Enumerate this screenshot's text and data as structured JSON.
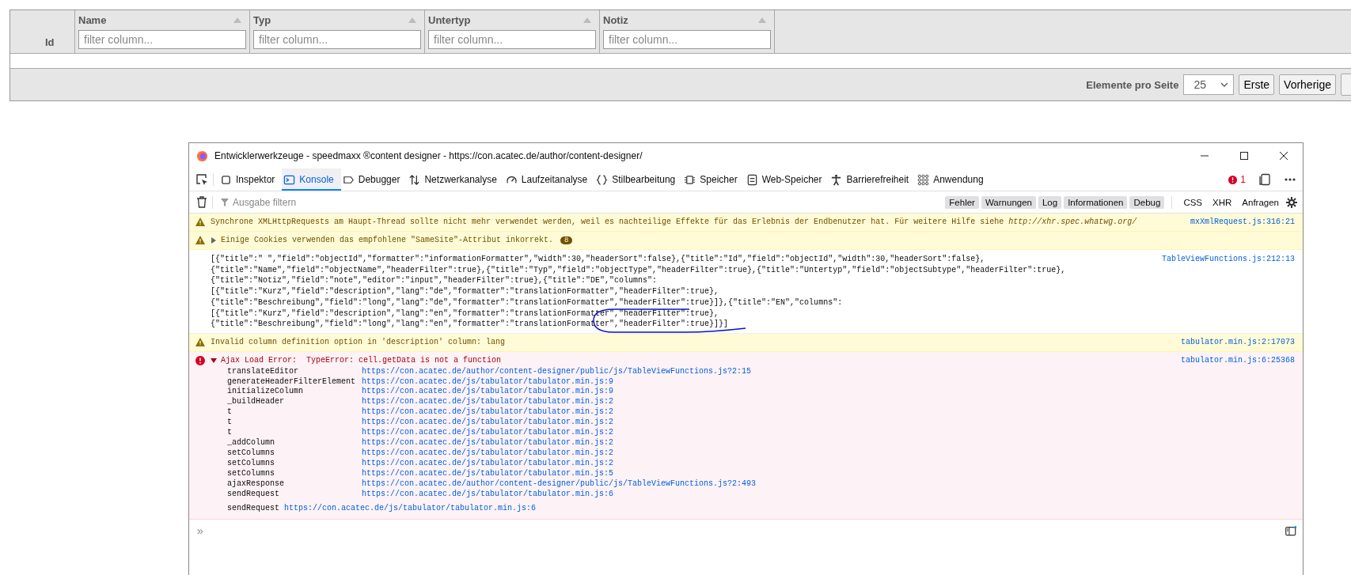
{
  "table": {
    "id_column": "Id",
    "columns": [
      {
        "title": "Name",
        "placeholder": "filter column..."
      },
      {
        "title": "Typ",
        "placeholder": "filter column..."
      },
      {
        "title": "Untertyp",
        "placeholder": "filter column..."
      },
      {
        "title": "Notiz",
        "placeholder": "filter column..."
      }
    ],
    "footer": {
      "label": "Elemente pro Seite",
      "page_size": "25",
      "buttons": [
        "Erste",
        "Vorherige"
      ]
    }
  },
  "devtools": {
    "title": "Entwicklerwerkzeuge - speedmaxx ®content designer - https://con.acatec.de/author/content-designer/",
    "tabs": [
      {
        "label": "Inspektor",
        "selected": false
      },
      {
        "label": "Konsole",
        "selected": true
      },
      {
        "label": "Debugger",
        "selected": false
      },
      {
        "label": "Netzwerkanalyse",
        "selected": false
      },
      {
        "label": "Laufzeitanalyse",
        "selected": false
      },
      {
        "label": "Stilbearbeitung",
        "selected": false
      },
      {
        "label": "Speicher",
        "selected": false
      },
      {
        "label": "Web-Speicher",
        "selected": false
      },
      {
        "label": "Barrierefreiheit",
        "selected": false
      },
      {
        "label": "Anwendung",
        "selected": false
      }
    ],
    "error_count": "1",
    "filter_placeholder": "Ausgabe filtern",
    "levels": [
      {
        "label": "Fehler",
        "selected": true
      },
      {
        "label": "Warnungen",
        "selected": true
      },
      {
        "label": "Log",
        "selected": true
      },
      {
        "label": "Informationen",
        "selected": true
      },
      {
        "label": "Debug",
        "selected": true
      }
    ],
    "requests": [
      {
        "label": "CSS",
        "selected": false
      },
      {
        "label": "XHR",
        "selected": false
      },
      {
        "label": "Anfragen",
        "selected": false
      }
    ],
    "messages": [
      {
        "kind": "warning",
        "lines": [
          "Synchrone XMLHttpRequests am Haupt-Thread sollte nicht mehr verwendet werden, weil es nachteilige Effekte für das Erlebnis der Endbenutzer hat. Für weitere Hilfe siehe "
        ],
        "link": "http://xhr.spec.whatwg.org/",
        "source": "mxXmlRequest.js:316:21"
      },
      {
        "kind": "warning",
        "expandable": true,
        "lines": [
          "Einige Cookies verwenden das empfohlene \"SameSite\"-Attribut inkorrekt."
        ],
        "badge": "8"
      },
      {
        "kind": "log",
        "annotated": true,
        "lines": [
          "[{\"title\":\" \",\"field\":\"objectId\",\"formatter\":\"informationFormatter\",\"width\":30,\"headerSort\":false},{\"title\":\"Id\",\"field\":\"objectId\",\"width\":30,\"headerSort\":false},",
          "{\"title\":\"Name\",\"field\":\"objectName\",\"headerFilter\":true},{\"title\":\"Typ\",\"field\":\"objectType\",\"headerFilter\":true},{\"title\":\"Untertyp\",\"field\":\"objectSubtype\",\"headerFilter\":true},",
          "{\"title\":\"Notiz\",\"field\":\"note\",\"editor\":\"input\",\"headerFilter\":true},{\"title\":\"DE\",\"columns\":",
          "[{\"title\":\"Kurz\",\"field\":\"description\",\"lang\":\"de\",\"formatter\":\"translationFormatter\",\"headerFilter\":true},",
          "{\"title\":\"Beschreibung\",\"field\":\"long\",\"lang\":\"de\",\"formatter\":\"translationFormatter\",\"headerFilter\":true}]},{\"title\":\"EN\",\"columns\":",
          "[{\"title\":\"Kurz\",\"field\":\"description\",\"lang\":\"en\",\"formatter\":\"translationFormatter\",\"headerFilter\":true},",
          "{\"title\":\"Beschreibung\",\"field\":\"long\",\"lang\":\"en\",\"formatter\":\"translationFormatter\",\"headerFilter\":true}]}]"
        ],
        "source": "TableViewFunctions.js:212:13"
      },
      {
        "kind": "warning",
        "lines": [
          "Invalid column definition option in 'description' column: lang"
        ],
        "source": "tabulator.min.js:2:17073"
      },
      {
        "kind": "error",
        "expanded": true,
        "lines": [
          "Ajax Load Error:  TypeError: cell.getData is not a function"
        ],
        "source": "tabulator.min.js:6:25368",
        "frames": [
          {
            "fn": "translateEditor",
            "url": "https://con.acatec.de/author/content-designer/public/js/TableViewFunctions.js?2:15"
          },
          {
            "fn": "generateHeaderFilterElement",
            "url": "https://con.acatec.de/js/tabulator/tabulator.min.js:9"
          },
          {
            "fn": "initializeColumn",
            "url": "https://con.acatec.de/js/tabulator/tabulator.min.js:9"
          },
          {
            "fn": "_buildHeader",
            "url": "https://con.acatec.de/js/tabulator/tabulator.min.js:2"
          },
          {
            "fn": "t",
            "url": "https://con.acatec.de/js/tabulator/tabulator.min.js:2"
          },
          {
            "fn": "t",
            "url": "https://con.acatec.de/js/tabulator/tabulator.min.js:2"
          },
          {
            "fn": "t",
            "url": "https://con.acatec.de/js/tabulator/tabulator.min.js:2"
          },
          {
            "fn": "_addColumn",
            "url": "https://con.acatec.de/js/tabulator/tabulator.min.js:2"
          },
          {
            "fn": "setColumns",
            "url": "https://con.acatec.de/js/tabulator/tabulator.min.js:2"
          },
          {
            "fn": "setColumns",
            "url": "https://con.acatec.de/js/tabulator/tabulator.min.js:2"
          },
          {
            "fn": "setColumns",
            "url": "https://con.acatec.de/js/tabulator/tabulator.min.js:5"
          },
          {
            "fn": "ajaxResponse",
            "url": "https://con.acatec.de/author/content-designer/public/js/TableViewFunctions.js?2:493"
          },
          {
            "fn": "sendRequest",
            "url": "https://con.acatec.de/js/tabulator/tabulator.min.js:6"
          }
        ],
        "async_frame": {
          "fn": "sendRequest",
          "url": "https://con.acatec.de/js/tabulator/tabulator.min.js:6"
        }
      }
    ],
    "prompt": "»"
  }
}
